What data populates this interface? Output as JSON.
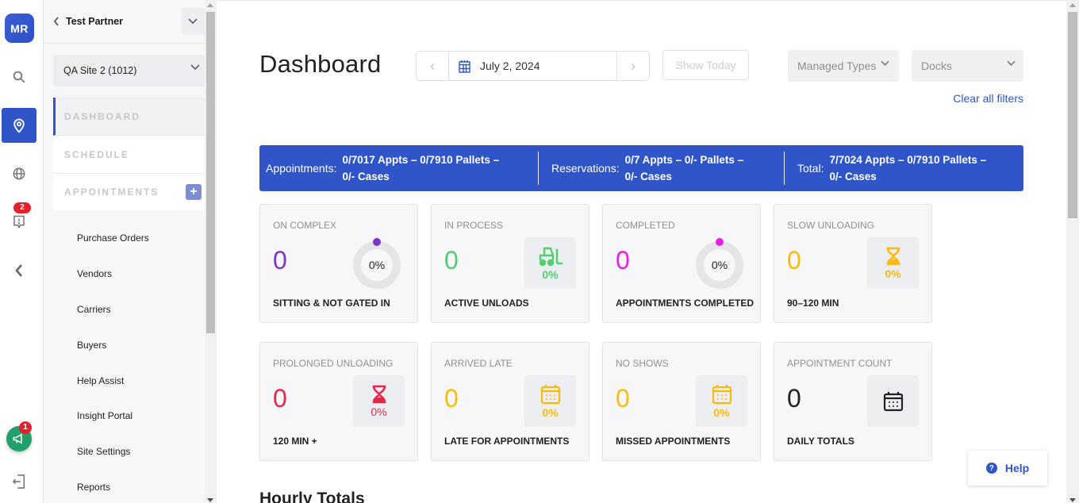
{
  "rail": {
    "avatar_initials": "MR",
    "icons": [
      "search-icon",
      "location-pin-icon",
      "globe-icon",
      "alert-icon",
      "chevron-left-icon",
      "megaphone-icon",
      "logout-icon"
    ],
    "alert_badge": "2",
    "announcement_badge": "1"
  },
  "sidebar": {
    "partner_name": "Test Partner",
    "site_select": "QA Site 2 (1012)",
    "nav": [
      {
        "label": "DASHBOARD",
        "active": true
      },
      {
        "label": "SCHEDULE",
        "active": false
      },
      {
        "label": "APPOINTMENTS",
        "active": false
      }
    ],
    "add_label": "+",
    "sub_items": [
      "Purchase Orders",
      "Vendors",
      "Carriers",
      "Buyers",
      "Help Assist",
      "Insight Portal",
      "Site Settings",
      "Reports"
    ]
  },
  "header": {
    "title": "Dashboard",
    "date": "July 2, 2024",
    "prev": "‹",
    "next": "›",
    "show_today": "Show Today",
    "managed_types": "Managed Types",
    "docks": "Docks",
    "clear_filters": "Clear all filters"
  },
  "summary": {
    "appointments_label": "Appointments:",
    "appointments_line1": "0/7017 Appts – 0/7910 Pallets –",
    "appointments_line2": "0/- Cases",
    "reservations_label": "Reservations:",
    "reservations_line1": "0/7 Appts – 0/- Pallets –",
    "reservations_line2": "0/- Cases",
    "total_label": "Total:",
    "total_line1": "7/7024 Appts – 0/7910 Pallets –",
    "total_line2": "0/- Cases"
  },
  "cards": [
    {
      "caption": "ON COMPLEX",
      "value": "0",
      "percent": "0%",
      "footer": "SITTING & NOT GATED IN",
      "color": "#7b35c9",
      "visual": "ring"
    },
    {
      "caption": "IN PROCESS",
      "value": "0",
      "percent": "0%",
      "footer": "ACTIVE UNLOADS",
      "color": "#4fcf70",
      "visual": "forklift-icon"
    },
    {
      "caption": "COMPLETED",
      "value": "0",
      "percent": "0%",
      "footer": "APPOINTMENTS COMPLETED",
      "color": "#ef1be8",
      "visual": "ring"
    },
    {
      "caption": "SLOW UNLOADING",
      "value": "0",
      "percent": "0%",
      "footer": "90–120 MIN",
      "color": "#f9bb0b",
      "visual": "hourglass-icon"
    },
    {
      "caption": "PROLONGED UNLOADING",
      "value": "0",
      "percent": "0%",
      "footer": "120 MIN +",
      "color": "#e8264a",
      "visual": "hourglass-icon"
    },
    {
      "caption": "ARRIVED LATE",
      "value": "0",
      "percent": "0%",
      "footer": "LATE FOR APPOINTMENTS",
      "color": "#f9bb0b",
      "visual": "calendar-icon"
    },
    {
      "caption": "NO SHOWS",
      "value": "0",
      "percent": "0%",
      "footer": "MISSED APPOINTMENTS",
      "color": "#f9bb0b",
      "visual": "calendar-icon"
    },
    {
      "caption": "APPOINTMENT COUNT",
      "value": "0",
      "percent": "",
      "footer": "DAILY TOTALS",
      "color": "#222222",
      "visual": "calendar-icon"
    }
  ],
  "section_title": "Hourly Totals",
  "help": {
    "label": "Help"
  },
  "colors": {
    "accent": "#2f55c9",
    "badge": "#e5212c",
    "fab": "#22a06b"
  }
}
